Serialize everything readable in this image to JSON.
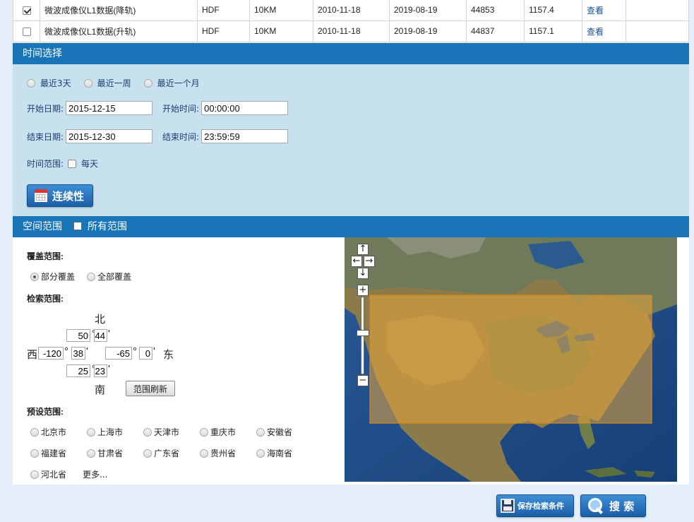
{
  "results": {
    "rows": [
      {
        "checked": true,
        "name": "微波成像仪L1数据(降轨)",
        "format": "HDF",
        "resolution": "10KM",
        "start": "2010-11-18",
        "end": "2019-08-19",
        "count": "44853",
        "size": "1157.4",
        "action": "查看"
      },
      {
        "checked": false,
        "name": "微波成像仪L1数据(升轨)",
        "format": "HDF",
        "resolution": "10KM",
        "start": "2010-11-18",
        "end": "2019-08-19",
        "count": "44837",
        "size": "1157.1",
        "action": "查看"
      }
    ]
  },
  "time": {
    "header": "时间选择",
    "quick": [
      "最近3天",
      "最近一周",
      "最近一个月"
    ],
    "start_date_label": "开始日期:",
    "start_date": "2015-12-15",
    "start_time_label": "开始时间:",
    "start_time": "00:00:00",
    "end_date_label": "结束日期:",
    "end_date": "2015-12-30",
    "end_time_label": "结束时间:",
    "end_time": "23:59:59",
    "range_label": "时间范围:",
    "daily_label": "每天",
    "continuity_button": "连续性"
  },
  "space": {
    "header": "空间范围",
    "all_label": "所有范围",
    "coverage_label": "覆盖范围:",
    "coverage_options": [
      "部分覆盖",
      "全部覆盖"
    ],
    "coverage_selected": 0,
    "search_label": "检索范围:",
    "north": "北",
    "south": "南",
    "west": "西",
    "east": "东",
    "north_deg": "50",
    "north_min": "44",
    "west_deg": "-120",
    "west_min": "38",
    "east_deg": "-65",
    "east_min": "0",
    "south_deg": "25",
    "south_min": "23",
    "degree_symbol": "°",
    "minute_symbol": "'",
    "refresh_button": "范围刷新",
    "preset_label": "预设范围:",
    "presets": [
      "北京市",
      "上海市",
      "天津市",
      "重庆市",
      "安徽省",
      "福建省",
      "甘肃省",
      "广东省",
      "贵州省",
      "海南省",
      "河北省"
    ],
    "more": "更多..."
  },
  "map": {
    "pan_up": "↑",
    "pan_left": "←",
    "pan_right": "→",
    "pan_down": "↓",
    "zoom_in": "+",
    "zoom_out": "−",
    "selection_color": "#e8a53c"
  },
  "buttons": {
    "save": "保存检索条件",
    "search": "搜 索"
  }
}
